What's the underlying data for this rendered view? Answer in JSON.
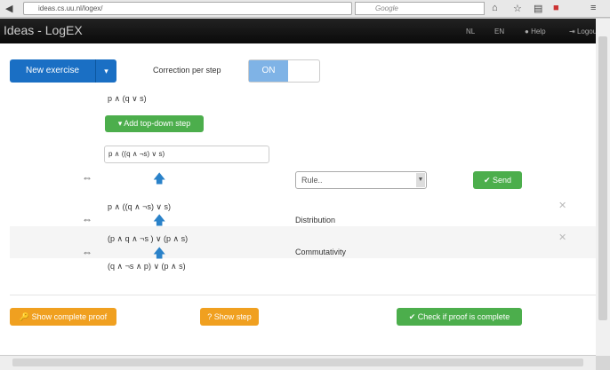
{
  "browser": {
    "url": "ideas.cs.uu.nl/logex/",
    "search_placeholder": "Google"
  },
  "nav": {
    "brand": "Ideas - LogEX",
    "links": [
      "NL",
      "EN",
      "Help",
      "Logout"
    ]
  },
  "toolbar": {
    "new_exercise": "New exercise",
    "correction_label": "Correction per step",
    "toggle_on": "ON"
  },
  "exercise": {
    "start": "p ∧ (q ∨ s)",
    "add_step": "Add top-down step",
    "input_value": "p ∧ ((q ∧ ¬s) ∨ s)",
    "rule_placeholder": "Rule..",
    "send": "Send",
    "equiv_q": "⇔"
  },
  "steps": [
    {
      "formula": "p ∧ ((q ∧ ¬s) ∨ s)",
      "rule": "Distribution"
    },
    {
      "formula": "(p ∧ q ∧ ¬s ) ∨ (p ∧ s)",
      "rule": "Commutativity"
    },
    {
      "formula": "(q ∧ ¬s ∧ p) ∨ (p ∧ s)"
    }
  ],
  "footer": {
    "show_proof": "Show complete proof",
    "show_step": "Show step",
    "check": "Check if proof is complete"
  },
  "colors": {
    "primary": "#1a6fc4",
    "success": "#4cae4c",
    "warning": "#f0a020"
  }
}
